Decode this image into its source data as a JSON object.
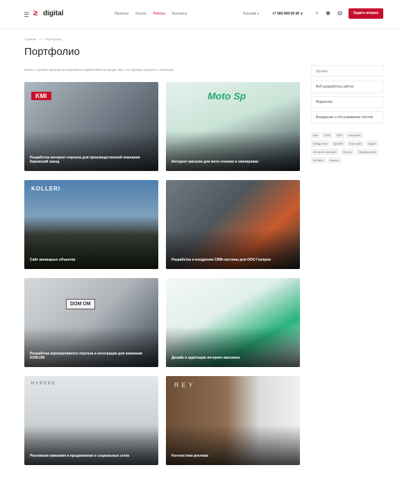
{
  "header": {
    "burger_icon": "menu-icon",
    "logo_mark": "≥",
    "logo_text": "digital",
    "nav": [
      "Проекты",
      "Услуги",
      "Работы",
      "Контакты"
    ],
    "active_nav_index": 2,
    "lang": "Русский ∨",
    "phone": "+7 000 000 00 00 ∨",
    "icons": [
      "search-icon",
      "user-icon",
      "globe-icon"
    ],
    "cta_label": "Задать вопрос",
    "accent": "#c8102e"
  },
  "page": {
    "breadcrumbs": [
      "Главная",
      "Портфолио"
    ],
    "title": "Портфолио",
    "intro": "Кейсы и лучшие практики по разработке digital-CRM-платформ. Всё, что сделано в работе с клиентом."
  },
  "cards": [
    {
      "brand": "KMI",
      "category": "",
      "name": "Разработка интернет-портала для производственной компании Кировский завод",
      "colors": [
        "#9aa7b0",
        "#4c5660"
      ]
    },
    {
      "brand": "Moto Sp",
      "category": "",
      "name": "Интернет-магазин для мото-техники и экипировки",
      "colors": [
        "#d8e8e2",
        "#27b17f"
      ]
    },
    {
      "brand": "KOLLERI",
      "category": "",
      "name": "Сайт жилищных объектов",
      "colors": [
        "#3c6a96",
        "#2a3a2a"
      ]
    },
    {
      "brand": "",
      "category": "",
      "name": "Разработка и внедрение CRM-системы для ООО Газпром",
      "colors": [
        "#5d6469",
        "#d9592c"
      ]
    },
    {
      "brand": "DOM OM",
      "category": "",
      "name": "Разработка корпоративного портала и интеграции для компании DOM.OM",
      "colors": [
        "#c7ccd0",
        "#3d4a56"
      ]
    },
    {
      "brand": "",
      "category": "",
      "name": "Дизайн и адаптация интернет-магазина",
      "colors": [
        "#e8f3ee",
        "#2ab27f"
      ]
    },
    {
      "brand": "НУРЕКС",
      "category": "",
      "name": "Рекламная кампания и продвижение в социальных сетях",
      "colors": [
        "#dbe0e3",
        "#8e959a"
      ]
    },
    {
      "brand": "REY",
      "category": "",
      "name": "Контекстная реклама",
      "colors": [
        "#8b6a4c",
        "#e6e6e6"
      ]
    }
  ],
  "sidebar": {
    "search_placeholder": "Дизайн",
    "items": [
      "Веб-разработка сайтов",
      "Маркетинг",
      "Внедрение и обслуживание систем"
    ],
    "tags": [
      "Всё",
      "CRM",
      "ERP",
      "Интранет",
      "Внедрение",
      "Дизайн",
      "Корп.сайт",
      "Аудит",
      "Интернет-магазин",
      "Портал",
      "Продвижение",
      "Мобайл",
      "Разное"
    ]
  }
}
